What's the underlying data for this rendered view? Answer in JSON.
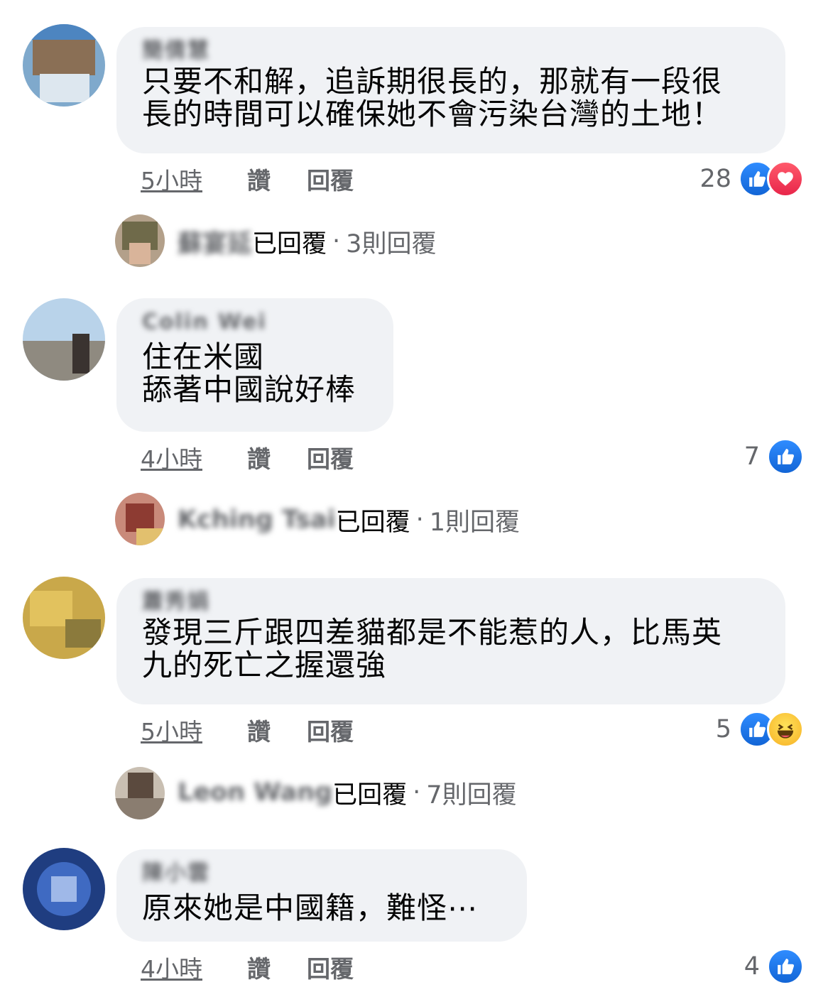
{
  "comments": [
    {
      "author": "簡倩慧",
      "lines": [
        "只要不和解，追訴期很長的，那就有一段很",
        "長的時間可以確保她不會污染台灣的土地！"
      ],
      "time": "5小時",
      "like_label": "讚",
      "reply_label": "回覆",
      "reaction_count": "28",
      "reactions": [
        "like",
        "love"
      ],
      "reply_summary": {
        "name": "蘇宴延",
        "label": "已回覆",
        "dot": "·",
        "count": "3則回覆"
      }
    },
    {
      "author": "Colin Wei",
      "lines": [
        "住在米國",
        "舔著中國說好棒"
      ],
      "time": "4小時",
      "like_label": "讚",
      "reply_label": "回覆",
      "reaction_count": "7",
      "reactions": [
        "like"
      ],
      "reply_summary": {
        "name": "Kching Tsai",
        "label": "已回覆",
        "dot": "·",
        "count": "1則回覆"
      }
    },
    {
      "author": "蕭秀娟",
      "lines": [
        "發現三斤跟四差貓都是不能惹的人，比馬英",
        "九的死亡之握還強"
      ],
      "time": "5小時",
      "like_label": "讚",
      "reply_label": "回覆",
      "reaction_count": "5",
      "reactions": [
        "like",
        "haha"
      ],
      "reply_summary": {
        "name": "Leon Wang",
        "label": "已回覆",
        "dot": "·",
        "count": "7則回覆"
      }
    },
    {
      "author": "陳小雲",
      "lines": [
        "原來她是中國籍，難怪⋯"
      ],
      "time": "4小時",
      "like_label": "讚",
      "reply_label": "回覆",
      "reaction_count": "4",
      "reactions": [
        "like"
      ]
    }
  ],
  "colors": {
    "bubble": "#f0f2f5",
    "secondary_text": "#65676b",
    "like_blue": "#1877f2",
    "love_red": "#f33e58",
    "haha_yellow": "#f7b125"
  }
}
